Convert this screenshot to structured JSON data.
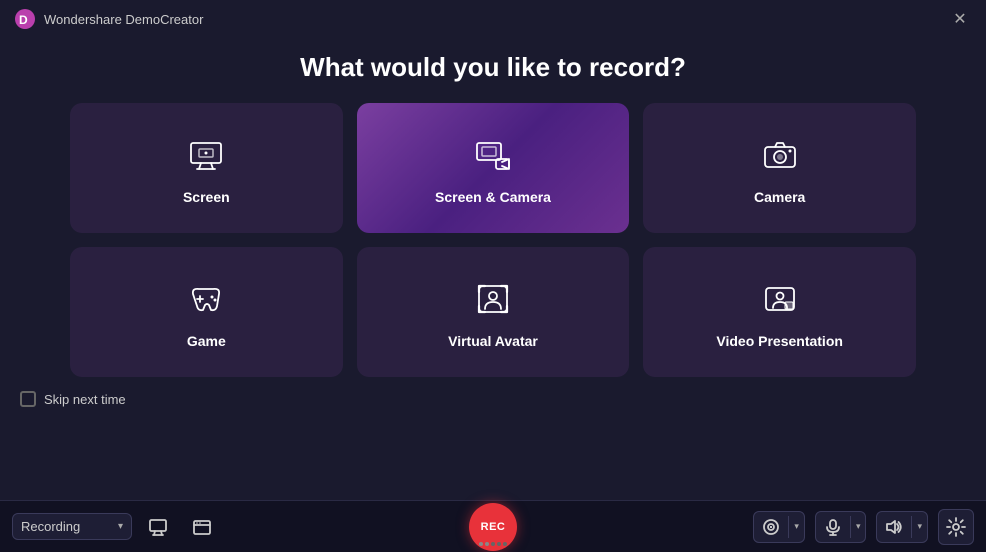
{
  "app": {
    "title": "Wondershare DemoCreator"
  },
  "page": {
    "heading": "What would you like to record?"
  },
  "cards": [
    {
      "id": "screen",
      "label": "Screen",
      "icon": "screen-icon",
      "active": false
    },
    {
      "id": "screen-camera",
      "label": "Screen & Camera",
      "icon": "screen-camera-icon",
      "active": true
    },
    {
      "id": "camera",
      "label": "Camera",
      "icon": "camera-icon",
      "active": false
    },
    {
      "id": "game",
      "label": "Game",
      "icon": "game-icon",
      "active": false
    },
    {
      "id": "virtual-avatar",
      "label": "Virtual Avatar",
      "icon": "virtual-avatar-icon",
      "active": false
    },
    {
      "id": "video-presentation",
      "label": "Video Presentation",
      "icon": "video-presentation-icon",
      "active": false
    }
  ],
  "skip": {
    "label": "Skip next time"
  },
  "toolbar": {
    "recording_label": "Recording",
    "rec_label": "REC"
  }
}
